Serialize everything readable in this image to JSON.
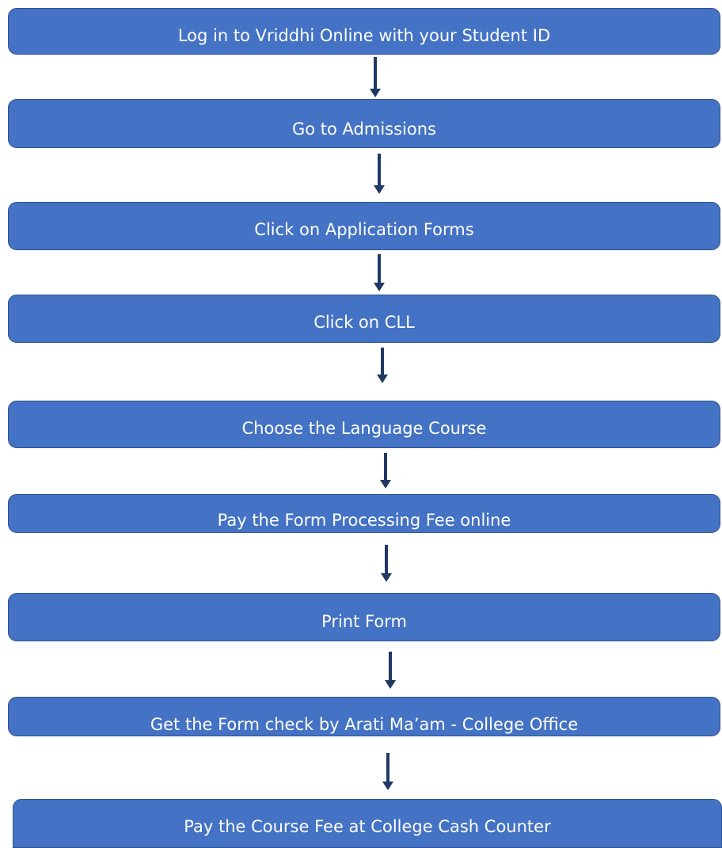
{
  "flowchart": {
    "steps": [
      {
        "label": "Log in to Vriddhi Online with your Student ID"
      },
      {
        "label": "Go to Admissions"
      },
      {
        "label": "Click on Application Forms"
      },
      {
        "label": "Click on CLL"
      },
      {
        "label": "Choose the Language Course"
      },
      {
        "label": "Pay the Form Processing Fee online"
      },
      {
        "label": "Print Form"
      },
      {
        "label": "Get the Form check by Arati Ma’am  - College Office"
      },
      {
        "label": "Pay the Course Fee at College Cash Counter"
      }
    ],
    "colors": {
      "box_fill": "#4472c4",
      "box_border": "#2f528f",
      "text": "#ffffff",
      "arrow": "#1f3864"
    }
  }
}
